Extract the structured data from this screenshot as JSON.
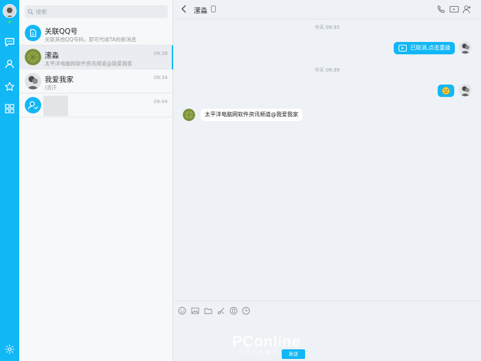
{
  "sidebar": {
    "search_placeholder": "搜索",
    "contacts": [
      {
        "name": "关联QQ号",
        "preview": "关联其他QQ号码，即可代收TA的新消息",
        "time": ""
      },
      {
        "name": "潆淼",
        "preview": "太平洋电脑网软件资讯频道@我爱我家",
        "time": "09:39"
      },
      {
        "name": "我爱我家",
        "preview": "/流汗",
        "time": "09:34"
      },
      {
        "name": "",
        "preview": "",
        "time": "09-04"
      }
    ]
  },
  "chat": {
    "title": "潆淼",
    "timestamps": [
      "今天 09:35",
      "今天 09:39"
    ],
    "messages": [
      {
        "direction": "out",
        "text": "已取消,点击重拨"
      },
      {
        "direction": "out",
        "text": ""
      },
      {
        "direction": "in",
        "text": "太平洋电脑网软件资讯频道@我爱我家"
      }
    ],
    "send_label": "发送"
  },
  "watermark": {
    "brand": "PConline",
    "sub": "太平洋电脑网"
  },
  "colors": {
    "accent": "#12b7f5",
    "online": "#3fe07a"
  }
}
